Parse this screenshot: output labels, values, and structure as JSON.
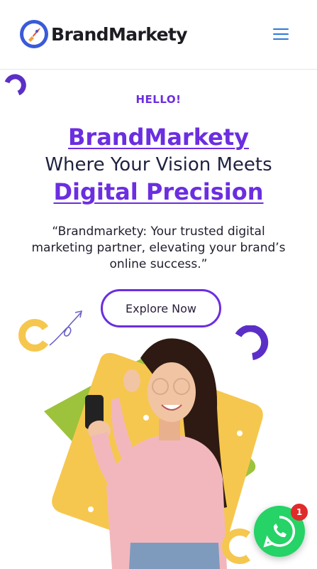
{
  "header": {
    "brand_name": "BrandMarkety",
    "logo_icon": "rocket-icon",
    "menu_icon": "hamburger-icon"
  },
  "hero": {
    "eyebrow": "HELLO!",
    "title_line1": "BrandMarkety",
    "title_line2": "Where Your Vision Meets",
    "title_line3": "Digital Precision",
    "quote": "“Brandmarkety: Your trusted digital marketing partner, elevating your brand’s online success.”",
    "cta_label": "Explore Now"
  },
  "floating": {
    "whatsapp_icon": "whatsapp-icon",
    "notification_count": "1"
  },
  "colors": {
    "accent": "#6b2ee0",
    "yellow": "#f6c74e",
    "green": "#9cc33b",
    "whatsapp": "#25d366"
  }
}
